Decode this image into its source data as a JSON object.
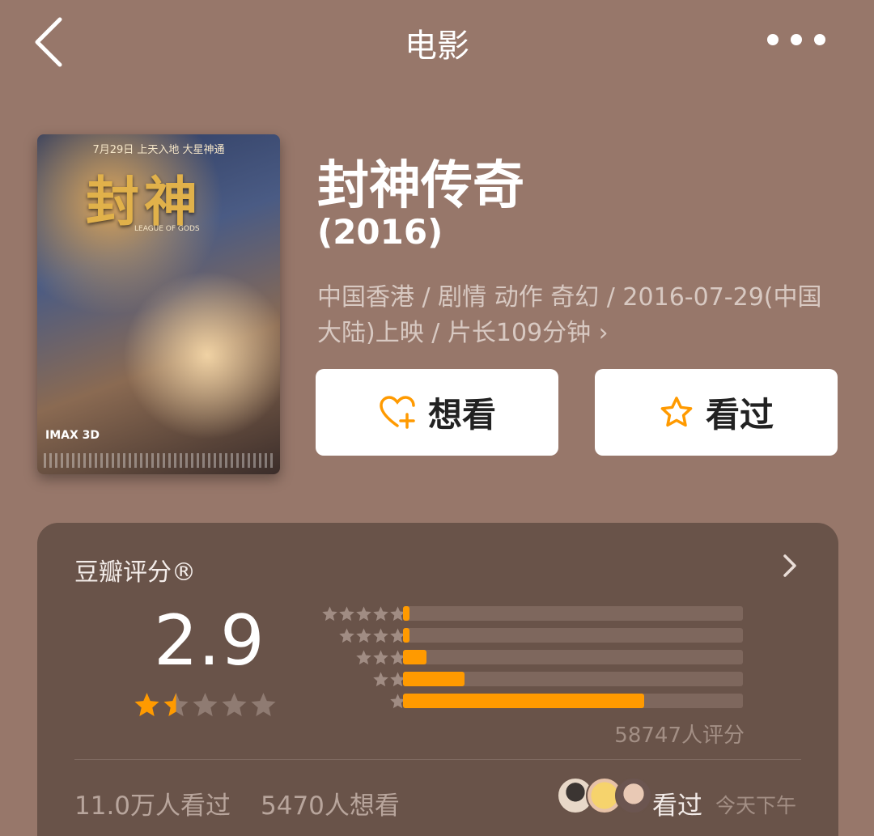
{
  "header": {
    "title": "电影",
    "back_icon": "chevron-left-icon",
    "more_icon": "more-dots-icon"
  },
  "poster": {
    "date_text": "7月29日  上天入地  大星神通",
    "logo_text": "封神",
    "sub_text": "LEAGUE OF GODS",
    "imax_text": "IMAX 3D"
  },
  "movie": {
    "title": "封神传奇",
    "year": "(2016)",
    "info": "中国香港 / 剧情 动作 奇幻 / 2016-07-29(中国大陆)上映 / 片长109分钟 ›"
  },
  "actions": {
    "want_label": "想看",
    "want_icon": "heart-plus-icon",
    "seen_label": "看过",
    "seen_icon": "star-outline-icon"
  },
  "rating": {
    "label": "豆瓣评分®",
    "score": "2.9",
    "score_stars": 1.5,
    "distribution": [
      {
        "stars": 5,
        "fraction": 0.02
      },
      {
        "stars": 4,
        "fraction": 0.01
      },
      {
        "stars": 3,
        "fraction": 0.07
      },
      {
        "stars": 2,
        "fraction": 0.18
      },
      {
        "stars": 1,
        "fraction": 0.71
      }
    ],
    "count_text": "58747人评分",
    "watched_text": "11.0万人看过",
    "want_text": "5470人想看",
    "friends_status": "看过",
    "friends_time": "今天下午"
  },
  "colors": {
    "accent": "#ff9a00",
    "background": "#97776a",
    "panel": "#695349"
  }
}
